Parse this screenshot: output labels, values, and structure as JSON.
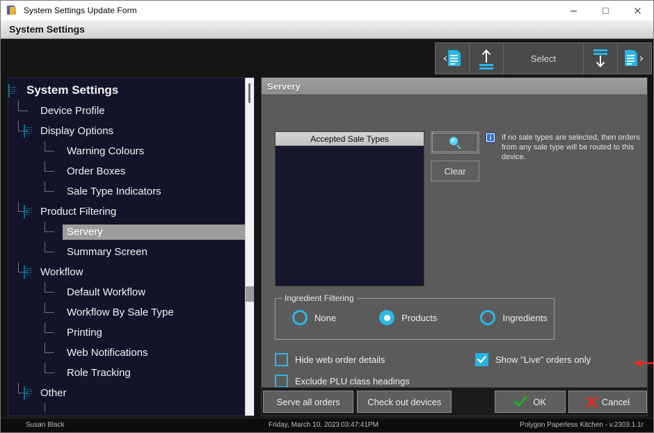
{
  "window": {
    "title": "System Settings Update Form",
    "banner_title": "System Settings",
    "minimize_label": "—",
    "maximize_label": "□",
    "close_label": "✕"
  },
  "toolbar": {
    "first_label": "",
    "prev_label": "",
    "select_label": "Select",
    "next_label": "",
    "last_label": ""
  },
  "tree": {
    "nodes": [
      {
        "label": "System Settings",
        "level": 0,
        "icon": "page-icon",
        "selected": false
      },
      {
        "label": "Device Profile",
        "level": 1,
        "icon": "bullet-icon",
        "selected": false
      },
      {
        "label": "Display Options",
        "level": 1,
        "icon": "page-icon",
        "selected": false
      },
      {
        "label": "Warning Colours",
        "level": 2,
        "icon": "bullet-icon",
        "selected": false
      },
      {
        "label": "Order Boxes",
        "level": 2,
        "icon": "bullet-icon",
        "selected": false
      },
      {
        "label": "Sale Type Indicators",
        "level": 2,
        "icon": "bullet-icon",
        "selected": false
      },
      {
        "label": "Product Filtering",
        "level": 1,
        "icon": "page-icon",
        "selected": false
      },
      {
        "label": "Servery",
        "level": 2,
        "icon": "bullet-icon",
        "selected": true
      },
      {
        "label": "Summary Screen",
        "level": 2,
        "icon": "bullet-icon",
        "selected": false
      },
      {
        "label": "Workflow",
        "level": 1,
        "icon": "page-icon",
        "selected": false
      },
      {
        "label": "Default Workflow",
        "level": 2,
        "icon": "bullet-icon",
        "selected": false
      },
      {
        "label": "Workflow By Sale Type",
        "level": 2,
        "icon": "bullet-icon",
        "selected": false
      },
      {
        "label": "Printing",
        "level": 2,
        "icon": "bullet-icon",
        "selected": false
      },
      {
        "label": "Web Notifications",
        "level": 2,
        "icon": "bullet-icon",
        "selected": false
      },
      {
        "label": "Role Tracking",
        "level": 2,
        "icon": "bullet-icon",
        "selected": false
      },
      {
        "label": "Other",
        "level": 1,
        "icon": "page-icon",
        "selected": false
      }
    ]
  },
  "detail": {
    "header": "Servery",
    "listbox": {
      "header": "Accepted Sale Types",
      "items": []
    },
    "search_button_label": "",
    "clear_button_label": "Clear",
    "info_badge": "i",
    "info_text": "If no sale types are selected, then orders from any sale type will be routed to this device.",
    "group": {
      "legend": "Ingredient Filtering",
      "options": [
        {
          "label": "None",
          "selected": false
        },
        {
          "label": "Products",
          "selected": true
        },
        {
          "label": "Ingredients",
          "selected": false
        }
      ]
    },
    "checkboxes": [
      {
        "label": "Hide web order details",
        "checked": false
      },
      {
        "label": "Exclude PLU class headings",
        "checked": false
      },
      {
        "label": "Show \"Live\" orders only",
        "checked": true
      }
    ]
  },
  "buttons": {
    "serve_all_orders": "Serve all orders",
    "check_out_devices": "Check out devices",
    "ok": "OK",
    "cancel": "Cancel"
  },
  "status": {
    "user": "Susan Black",
    "date": "Friday, March 10, 2023",
    "time": "03:47:41PM",
    "app": "Polygon Paperless Kitchen - v.2303.1.1r"
  },
  "colors": {
    "accent_cyan": "#2ab8e6",
    "annotation_red": "#ee2b26",
    "ok_green": "#20b020",
    "cancel_red": "#e03020"
  }
}
